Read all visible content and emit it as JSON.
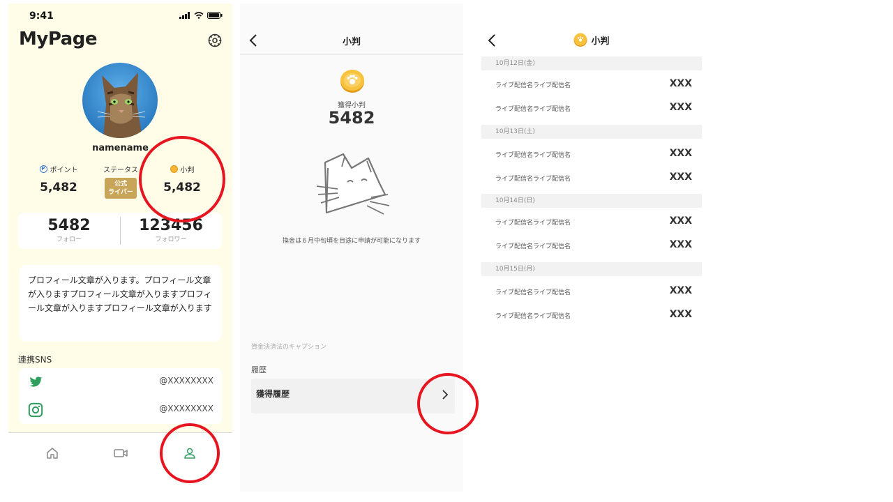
{
  "mypage": {
    "time": "9:41",
    "title": "MyPage",
    "username": "namename",
    "stats": {
      "points_label": "ポイント",
      "points_value": "5,482",
      "status_label": "ステータス",
      "status_badge_line1": "公式",
      "status_badge_line2": "ライバー",
      "koban_label": "小判",
      "koban_value": "5,482"
    },
    "follow": {
      "following_count": "5482",
      "following_label": "フォロー",
      "followers_count": "123456",
      "followers_label": "フォロワー"
    },
    "profile_text": "プロフィール文章が入ります。プロフィール文章が入りますプロフィール文章が入りますプロフィール文章が入りますプロフィール文章が入ります",
    "sns": {
      "label": "連携SNS",
      "items": [
        {
          "icon": "twitter-icon",
          "handle": "@XXXXXXXX"
        },
        {
          "icon": "instagram-icon",
          "handle": "@XXXXXXXX"
        }
      ]
    },
    "tabs": [
      "home-icon",
      "video-icon",
      "person-icon"
    ],
    "colors": {
      "background": "#fffde8",
      "accent_green": "#2e9e5e",
      "badge_gold": "#c9a55a"
    }
  },
  "koban_page": {
    "title": "小判",
    "earned_label": "獲得小判",
    "earned_value": "5482",
    "notice": "換金は６月中旬頃を目途に申請が可能になります",
    "caption": "資金決済法のキャプション",
    "history_label": "履歴",
    "history_item": "獲得履歴"
  },
  "history_page": {
    "title": "小判",
    "groups": [
      {
        "date": "10月12日(金)",
        "items": [
          {
            "name": "ライブ配信名ライブ配信名",
            "value": "XXX"
          },
          {
            "name": "ライブ配信名ライブ配信名",
            "value": "XXX"
          }
        ]
      },
      {
        "date": "10月13日(土)",
        "items": [
          {
            "name": "ライブ配信名ライブ配信名",
            "value": "XXX"
          },
          {
            "name": "ライブ配信名ライブ配信名",
            "value": "XXX"
          }
        ]
      },
      {
        "date": "10月14日(日)",
        "items": [
          {
            "name": "ライブ配信名ライブ配信名",
            "value": "XXX"
          },
          {
            "name": "ライブ配信名ライブ配信名",
            "value": "XXX"
          }
        ]
      },
      {
        "date": "10月15日(月)",
        "items": [
          {
            "name": "ライブ配信名ライブ配信名",
            "value": "XXX"
          },
          {
            "name": "ライブ配信名ライブ配信名",
            "value": "XXX"
          }
        ]
      }
    ]
  },
  "annotations": {
    "highlight_color": "#e6151f"
  }
}
